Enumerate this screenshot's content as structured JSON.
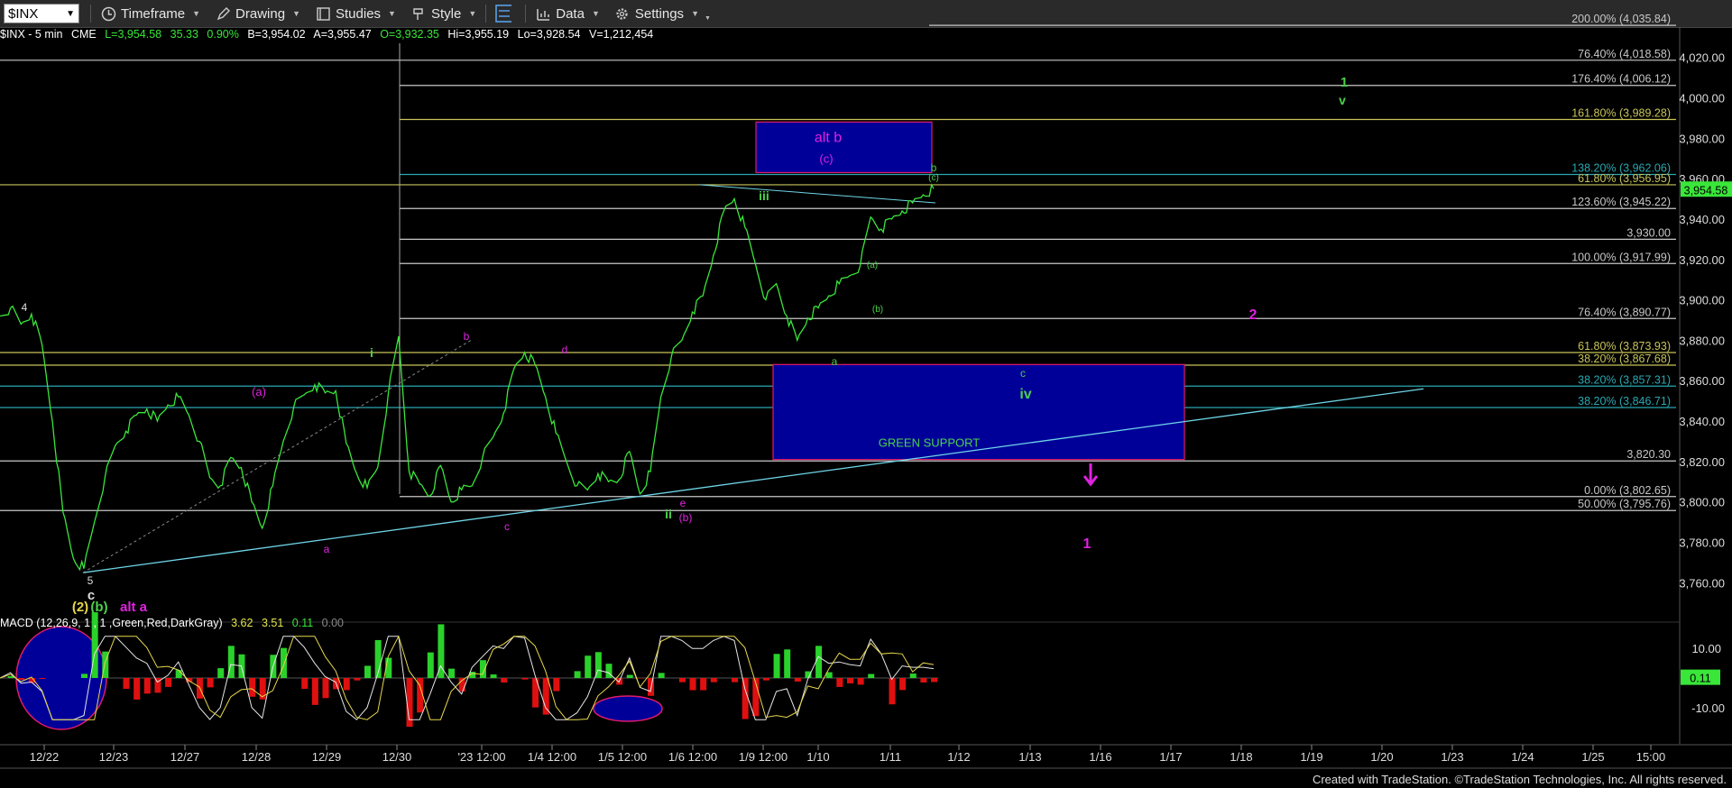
{
  "toolbar": {
    "symbol": "$INX",
    "buttons": [
      {
        "label": "Timeframe",
        "icon": "clock-icon"
      },
      {
        "label": "Drawing",
        "icon": "pen-icon"
      },
      {
        "label": "Studies",
        "icon": "studies-icon"
      },
      {
        "label": "Style",
        "icon": "brush-icon"
      },
      {
        "label": "",
        "icon": "layout-icon"
      },
      {
        "label": "Data",
        "icon": "data-icon"
      },
      {
        "label": "Settings",
        "icon": "gear-icon"
      }
    ]
  },
  "header": {
    "name": "$INX - 5 min",
    "exchange": "CME",
    "last": "L=3,954.58",
    "change": "35.33",
    "pct": "0.90%",
    "bid": "B=3,954.02",
    "ask": "A=3,955.47",
    "open": "O=3,932.35",
    "hi": "Hi=3,955.19",
    "lo": "Lo=3,928.54",
    "vol": "V=1,212,454"
  },
  "macd": {
    "label": "MACD (12,26,9, 1 , 1 ,Green,Red,DarkGray)",
    "v1": "3.62",
    "v2": "3.51",
    "v3": "0.11",
    "v4": "0.00",
    "axis": [
      "10.00",
      "-10.00"
    ],
    "last": "0.11"
  },
  "footer": "Created with TradeStation. ©TradeStation Technologies, Inc. All rights reserved.",
  "chart_data": {
    "type": "line",
    "title": "$INX - 5 min",
    "ylim": [
      3745,
      4035
    ],
    "y_ticks": [
      "4,020.00",
      "4,000.00",
      "3,980.00",
      "3,960.00",
      "3,940.00",
      "3,920.00",
      "3,900.00",
      "3,880.00",
      "3,860.00",
      "3,840.00",
      "3,820.00",
      "3,800.00",
      "3,780.00",
      "3,760.00"
    ],
    "x_ticks": [
      "12/22",
      "12/23",
      "12/27",
      "12/28",
      "12/29",
      "12/30",
      "'23 12:00",
      "1/4 12:00",
      "1/5 12:00",
      "1/6 12:00",
      "1/9 12:00",
      "1/10",
      "1/11",
      "1/12",
      "1/13",
      "1/16",
      "1/17",
      "1/18",
      "1/19",
      "1/20",
      "1/23",
      "1/24",
      "1/25",
      "15:00"
    ],
    "last_price": "3,954.58",
    "series": [
      {
        "values": [
          3892,
          3896,
          3888,
          3893,
          3878,
          3840,
          3795,
          3772,
          3767,
          3790,
          3812,
          3828,
          3835,
          3843,
          3846,
          3840,
          3848,
          3852,
          3843,
          3830,
          3812,
          3808,
          3822,
          3817,
          3800,
          3787,
          3808,
          3830,
          3847,
          3853,
          3858,
          3854,
          3855,
          3829,
          3814,
          3807,
          3817,
          3853,
          3882,
          3815,
          3809,
          3803,
          3818,
          3800,
          3806,
          3808,
          3822,
          3832,
          3844,
          3866,
          3874,
          3868,
          3852,
          3834,
          3820,
          3808,
          3806,
          3814,
          3810,
          3811,
          3825,
          3804,
          3815,
          3852,
          3872,
          3880,
          3894,
          3902,
          3922,
          3944,
          3950,
          3936,
          3918,
          3900,
          3908,
          3892,
          3880,
          3891,
          3896,
          3902,
          3908,
          3912,
          3917,
          3941,
          3935,
          3940,
          3944,
          3948,
          3952,
          3955
        ]
      }
    ]
  },
  "levels": [
    {
      "label": "200.00% (4,035.84)",
      "color": "#c8c8c8"
    },
    {
      "label": "76.40% (4,018.58)",
      "color": "#c8c8c8"
    },
    {
      "label": "176.40% (4,006.12)",
      "color": "#c8c8c8"
    },
    {
      "label": "161.80% (3,989.28)",
      "color": "#c8c45a"
    },
    {
      "label": "138.20% (3,962.06)",
      "color": "#2aa7b0"
    },
    {
      "label": "61.80% (3,956.95)",
      "color": "#c8c45a"
    },
    {
      "label": "123.60% (3,945.22)",
      "color": "#c8c8c8"
    },
    {
      "label": "3,930.00",
      "color": "#c8c8c8"
    },
    {
      "label": "100.00% (3,917.99)",
      "color": "#c8c8c8"
    },
    {
      "label": "76.40% (3,890.77)",
      "color": "#c8c8c8"
    },
    {
      "label": "61.80% (3,873.93)",
      "color": "#c8c45a"
    },
    {
      "label": "38.20% (3,867.68)",
      "color": "#c8c45a"
    },
    {
      "label": "38.20% (3,857.31)",
      "color": "#2aa7b0"
    },
    {
      "label": "38.20% (3,846.71)",
      "color": "#2aa7b0"
    },
    {
      "label": "3,820.30",
      "color": "#c8c8c8"
    },
    {
      "label": "0.00% (3,802.65)",
      "color": "#c8c8c8"
    },
    {
      "label": "50.00% (3,795.76)",
      "color": "#c8c8c8"
    }
  ],
  "boxes": {
    "alt_b": {
      "title": "alt b",
      "sub": "(c)"
    },
    "support": {
      "title": "GREEN SUPPORT"
    }
  },
  "annotations": {
    "green": [
      "i",
      "ii",
      "iii",
      "iv",
      "v",
      "1",
      "a",
      "b",
      "(a)",
      "(b)",
      "(c)",
      "c",
      "b"
    ],
    "magenta": [
      "(a)",
      "a",
      "b",
      "c",
      "d",
      "e",
      "(b)",
      "2",
      "1",
      "alt a"
    ],
    "white": [
      "4",
      "5",
      "c"
    ],
    "yellow": [
      "(2)"
    ],
    "green_b": [
      "(b)"
    ]
  },
  "colors": {
    "price": "#39e639",
    "magenta": "#e022e0",
    "green_lbl": "#4cd14c",
    "axis_bg": "#000"
  }
}
